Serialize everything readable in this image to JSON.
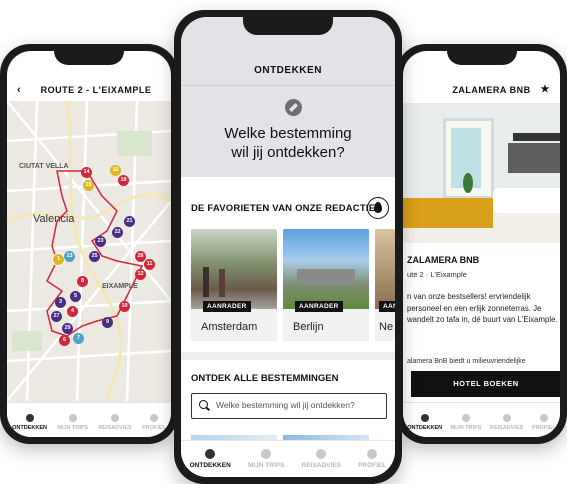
{
  "left_phone": {
    "title": "ROUTE 2 - L'EIXAMPLE",
    "map_labels": {
      "ciutat_vella": "CIUTAT VELLA",
      "valencia": "Valencia",
      "eixample": "EIXAMPLE"
    },
    "markers": [
      "14",
      "15",
      "16",
      "18",
      "21",
      "22",
      "23",
      "25",
      "26",
      "27",
      "29",
      "3",
      "4",
      "5",
      "6",
      "7",
      "8",
      "9",
      "10",
      "11",
      "12",
      "13",
      "16",
      "17",
      "19",
      "1"
    ],
    "tabs": [
      "ONTDEKKEN",
      "MIJN TRIPS",
      "REISADVIES",
      "PROFIEL"
    ]
  },
  "center_phone": {
    "title": "ONTDEKKEN",
    "question_line1": "Welke bestemming",
    "question_line2": "wil jij ontdekken?",
    "favorites_heading": "DE FAVORIETEN VAN ONZE REDACTIE",
    "cards": [
      {
        "badge": "AANRADER",
        "city": "Amsterdam"
      },
      {
        "badge": "AANRADER",
        "city": "Berlijn"
      },
      {
        "badge": "AANRADER",
        "city": "Ne"
      }
    ],
    "all_heading": "ONTDEK ALLE BESTEMMINGEN",
    "search_placeholder": "Welke bestemming wil jij ontdekken?",
    "tabs": [
      "ONTDEKKEN",
      "MIJN TRIPS",
      "REISADVIES",
      "PROFIEL"
    ]
  },
  "right_phone": {
    "title": "ZALAMERA BNB",
    "hotel_name": "ZALAMERA BNB",
    "meta": "ute 2 · L'Eixample",
    "desc": "n van onze bestsellers! ervriendelijk personeel en een erlijk zonneterras. Je wandelt zo tafa in, dé buurt van L'Eixample.",
    "desc2": "alamera BnB biedt u milieuvriendelijke",
    "button": "HOTEL BOEKEN",
    "tabs": [
      "ONTDEKKEN",
      "MIJN TRIPS",
      "REISADVIES",
      "PROFIEL"
    ]
  }
}
